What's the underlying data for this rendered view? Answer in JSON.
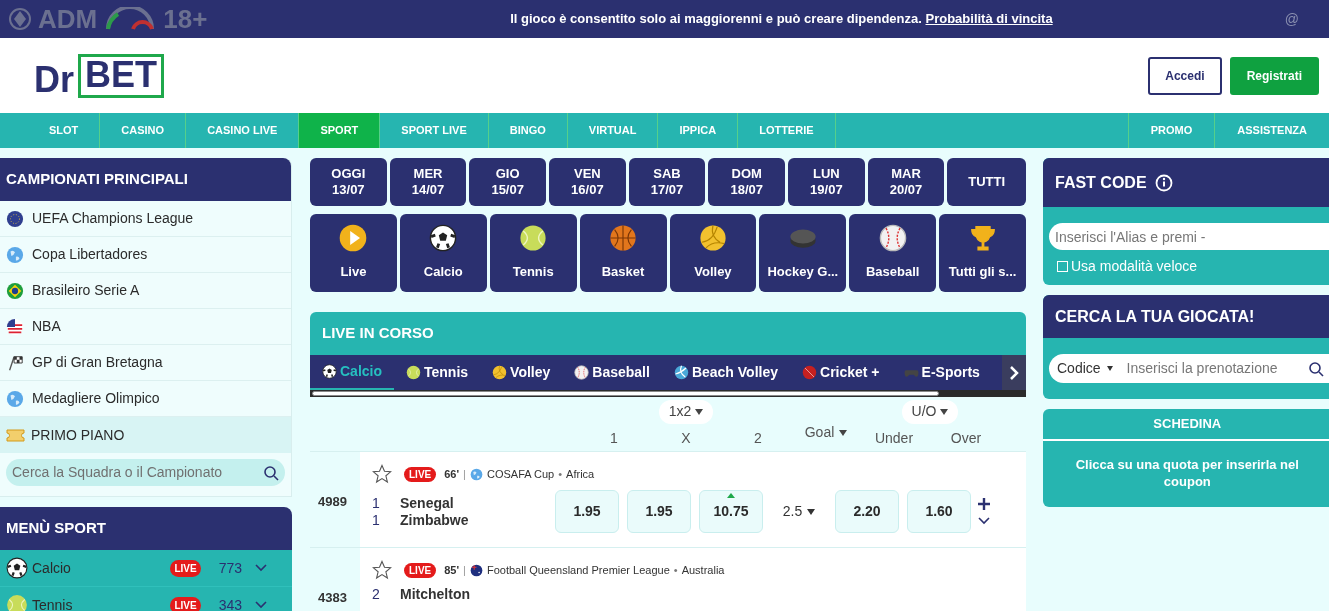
{
  "topbar": {
    "brand": "ADM",
    "age": "18+",
    "notice": "Il gioco è consentito solo ai maggiorenni e può creare dipendenza.",
    "link": "Probabilità di vincita",
    "corner": "@"
  },
  "header": {
    "logo": [
      "Dr",
      "BET"
    ],
    "login": "Accedi",
    "register": "Registrati"
  },
  "nav": {
    "items": [
      {
        "label": "SLOT",
        "selected": false
      },
      {
        "label": "CASINO",
        "selected": false
      },
      {
        "label": "CASINO LIVE",
        "selected": false
      },
      {
        "label": "SPORT",
        "selected": true
      },
      {
        "label": "SPORT LIVE",
        "selected": false
      },
      {
        "label": "BINGO",
        "selected": false
      },
      {
        "label": "VIRTUAL",
        "selected": false
      },
      {
        "label": "IPPICA",
        "selected": false
      },
      {
        "label": "LOTTERIE",
        "selected": false
      }
    ],
    "right": [
      "PROMO",
      "ASSISTENZA"
    ]
  },
  "leagues": {
    "title": "CAMPIONATI PRINCIPALI",
    "items": [
      {
        "label": "UEFA Champions League",
        "kind": "eu"
      },
      {
        "label": "Copa Libertadores",
        "kind": "globe"
      },
      {
        "label": "Brasileiro Serie A",
        "kind": "brazil"
      },
      {
        "label": "NBA",
        "kind": "usa"
      },
      {
        "label": "GP di Gran Bretagna",
        "kind": "checkered"
      },
      {
        "label": "Medagliere Olimpico",
        "kind": "globe"
      }
    ],
    "featured": "PRIMO PIANO",
    "search_placeholder": "Cerca la Squadra o il Campionato"
  },
  "menu_sport": {
    "title": "MENÙ SPORT",
    "items": [
      {
        "label": "Calcio",
        "kind": "soccer",
        "badge": "LIVE",
        "count": "773"
      },
      {
        "label": "Tennis",
        "kind": "tennis",
        "badge": "LIVE",
        "count": "343"
      }
    ]
  },
  "dates": [
    {
      "day": "OGGI",
      "date": "13/07"
    },
    {
      "day": "MER",
      "date": "14/07"
    },
    {
      "day": "GIO",
      "date": "15/07"
    },
    {
      "day": "VEN",
      "date": "16/07"
    },
    {
      "day": "SAB",
      "date": "17/07"
    },
    {
      "day": "DOM",
      "date": "18/07"
    },
    {
      "day": "LUN",
      "date": "19/07"
    },
    {
      "day": "MAR",
      "date": "20/07"
    },
    {
      "day": "TUTTI"
    }
  ],
  "sports": [
    {
      "label": "Live",
      "kind": "play"
    },
    {
      "label": "Calcio",
      "kind": "soccer"
    },
    {
      "label": "Tennis",
      "kind": "tennis"
    },
    {
      "label": "Basket",
      "kind": "basket"
    },
    {
      "label": "Volley",
      "kind": "volley"
    },
    {
      "label": "Hockey G...",
      "kind": "puck"
    },
    {
      "label": "Baseball",
      "kind": "baseball"
    },
    {
      "label": "Tutti gli s...",
      "kind": "trophy"
    }
  ],
  "live": {
    "title": "LIVE IN CORSO",
    "tabs": [
      {
        "label": "Calcio",
        "kind": "soccer",
        "selected": true
      },
      {
        "label": "Tennis",
        "kind": "tennis",
        "selected": false
      },
      {
        "label": "Volley",
        "kind": "volley",
        "selected": false
      },
      {
        "label": "Baseball",
        "kind": "baseball",
        "selected": false
      },
      {
        "label": "Beach Volley",
        "kind": "beach",
        "selected": false
      },
      {
        "label": "Cricket +",
        "kind": "cricket",
        "selected": false
      },
      {
        "label": "E-Sports",
        "kind": "gamepad",
        "selected": false
      }
    ],
    "market1": "1x2",
    "cols1": [
      "1",
      "X",
      "2"
    ],
    "goal": "Goal",
    "market2": "U/O",
    "cols2": [
      "Under",
      "Over"
    ],
    "matches": [
      {
        "code": "4989",
        "badge": "LIVE",
        "minute": "66'",
        "separator": "|",
        "kind": "globe",
        "competition": "COSAFA Cup",
        "bullet": "•",
        "region": "Africa",
        "teams": [
          {
            "score": "1",
            "name": "Senegal"
          },
          {
            "score": "1",
            "name": "Zimbabwe"
          }
        ],
        "odds": [
          {
            "value": "1.95",
            "rising": false
          },
          {
            "value": "1.95",
            "rising": false
          },
          {
            "value": "10.75",
            "rising": true
          }
        ],
        "line": "2.5",
        "ou": [
          {
            "value": "2.20",
            "rising": false
          },
          {
            "value": "1.60",
            "rising": false
          }
        ]
      },
      {
        "code": "4383",
        "badge": "LIVE",
        "minute": "85'",
        "separator": "|",
        "kind": "australia",
        "competition": "Football Queensland Premier League",
        "bullet": "•",
        "region": "Australia",
        "teams": [
          {
            "score": "2",
            "name": "Mitchelton"
          }
        ]
      }
    ]
  },
  "fast_code": {
    "title": "FAST CODE",
    "placeholder": "Inserisci l'Alias e premi -",
    "checkbox": {
      "label": "Usa modalità veloce",
      "checked": false
    }
  },
  "find_bet": {
    "title": "CERCA LA TUA GIOCATA!",
    "select": "Codice",
    "placeholder": "Inserisci la prenotazione"
  },
  "slip": {
    "title": "SCHEDINA",
    "message": "Clicca su una quota per inserirla nel coupon"
  }
}
